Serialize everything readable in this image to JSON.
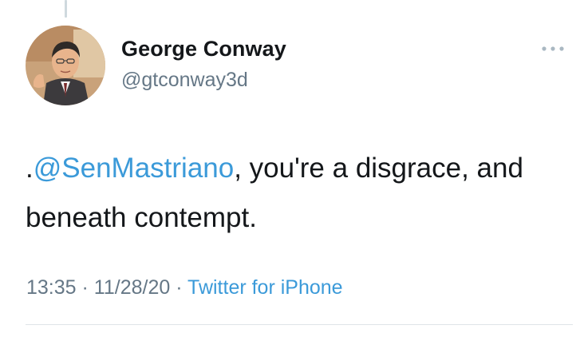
{
  "tweet": {
    "author_name": "George Conway",
    "author_handle": "@gtconway3d",
    "text_prefix": ".",
    "mention": "@SenMastriano",
    "text_rest": ", you're a disgrace, and beneath contempt.",
    "time": "13:35",
    "date": "11/28/20",
    "separator": "·",
    "source": "Twitter for iPhone"
  },
  "icons": {
    "more": "more-dots-icon",
    "avatar": "avatar-illustration"
  },
  "colors": {
    "link": "#3b9ad9",
    "secondary_text": "#657786",
    "primary_text": "#14171a"
  }
}
